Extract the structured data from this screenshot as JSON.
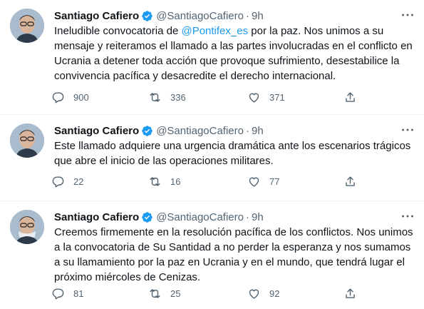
{
  "tweets": [
    {
      "name": "Santiago Cafiero",
      "handle": "@SantiagoCafiero",
      "dot": "·",
      "time": "9h",
      "text_before": "Ineludible convocatoria de ",
      "mention": "@Pontifex_es",
      "text_after": " por la paz. Nos unimos a su mensaje y reiteramos el llamado a las partes involucradas en el conflicto en Ucrania a detener toda acción que provoque sufrimiento, desestabilice la convivencia pacífica y desacredite el derecho internacional.",
      "replies": "900",
      "retweets": "336",
      "likes": "371"
    },
    {
      "name": "Santiago Cafiero",
      "handle": "@SantiagoCafiero",
      "dot": "·",
      "time": "9h",
      "text": "Este llamado adquiere una urgencia dramática ante los escenarios trágicos que abre el inicio de las operaciones militares.",
      "replies": "22",
      "retweets": "16",
      "likes": "77"
    },
    {
      "name": "Santiago Cafiero",
      "handle": "@SantiagoCafiero",
      "dot": "·",
      "time": "9h",
      "text": "Creemos firmemente en la resolución pacífica de los conflictos. Nos unimos a la convocatoria de Su Santidad a no perder la esperanza y nos sumamos a su llamamiento por la paz en Ucrania y en el mundo, que tendrá lugar el próximo miércoles de Cenizas.",
      "replies": "81",
      "retweets": "25",
      "likes": "92"
    }
  ],
  "colors": {
    "text": "#0f1419",
    "secondary": "#536471",
    "accent": "#1d9bf0",
    "divider": "#eff3f4"
  },
  "icons": [
    "verified-badge-icon",
    "more-icon",
    "reply-icon",
    "retweet-icon",
    "like-icon",
    "share-icon"
  ]
}
